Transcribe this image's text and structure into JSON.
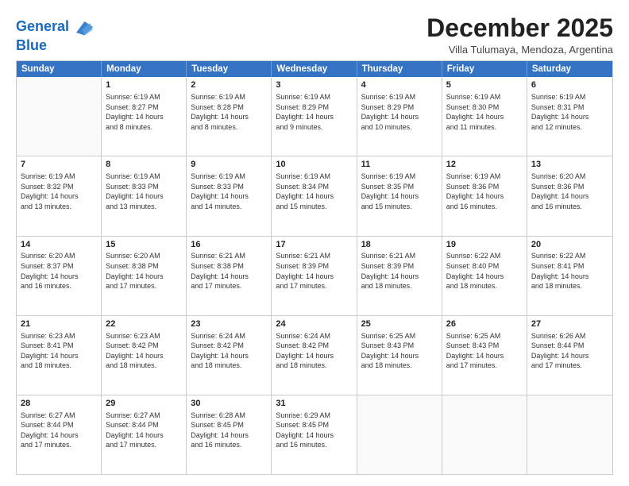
{
  "logo": {
    "line1": "General",
    "line2": "Blue"
  },
  "title": "December 2025",
  "subtitle": "Villa Tulumaya, Mendoza, Argentina",
  "header_days": [
    "Sunday",
    "Monday",
    "Tuesday",
    "Wednesday",
    "Thursday",
    "Friday",
    "Saturday"
  ],
  "weeks": [
    [
      {
        "day": "",
        "info": ""
      },
      {
        "day": "1",
        "info": "Sunrise: 6:19 AM\nSunset: 8:27 PM\nDaylight: 14 hours\nand 8 minutes."
      },
      {
        "day": "2",
        "info": "Sunrise: 6:19 AM\nSunset: 8:28 PM\nDaylight: 14 hours\nand 8 minutes."
      },
      {
        "day": "3",
        "info": "Sunrise: 6:19 AM\nSunset: 8:29 PM\nDaylight: 14 hours\nand 9 minutes."
      },
      {
        "day": "4",
        "info": "Sunrise: 6:19 AM\nSunset: 8:29 PM\nDaylight: 14 hours\nand 10 minutes."
      },
      {
        "day": "5",
        "info": "Sunrise: 6:19 AM\nSunset: 8:30 PM\nDaylight: 14 hours\nand 11 minutes."
      },
      {
        "day": "6",
        "info": "Sunrise: 6:19 AM\nSunset: 8:31 PM\nDaylight: 14 hours\nand 12 minutes."
      }
    ],
    [
      {
        "day": "7",
        "info": "Sunrise: 6:19 AM\nSunset: 8:32 PM\nDaylight: 14 hours\nand 13 minutes."
      },
      {
        "day": "8",
        "info": "Sunrise: 6:19 AM\nSunset: 8:33 PM\nDaylight: 14 hours\nand 13 minutes."
      },
      {
        "day": "9",
        "info": "Sunrise: 6:19 AM\nSunset: 8:33 PM\nDaylight: 14 hours\nand 14 minutes."
      },
      {
        "day": "10",
        "info": "Sunrise: 6:19 AM\nSunset: 8:34 PM\nDaylight: 14 hours\nand 15 minutes."
      },
      {
        "day": "11",
        "info": "Sunrise: 6:19 AM\nSunset: 8:35 PM\nDaylight: 14 hours\nand 15 minutes."
      },
      {
        "day": "12",
        "info": "Sunrise: 6:19 AM\nSunset: 8:36 PM\nDaylight: 14 hours\nand 16 minutes."
      },
      {
        "day": "13",
        "info": "Sunrise: 6:20 AM\nSunset: 8:36 PM\nDaylight: 14 hours\nand 16 minutes."
      }
    ],
    [
      {
        "day": "14",
        "info": "Sunrise: 6:20 AM\nSunset: 8:37 PM\nDaylight: 14 hours\nand 16 minutes."
      },
      {
        "day": "15",
        "info": "Sunrise: 6:20 AM\nSunset: 8:38 PM\nDaylight: 14 hours\nand 17 minutes."
      },
      {
        "day": "16",
        "info": "Sunrise: 6:21 AM\nSunset: 8:38 PM\nDaylight: 14 hours\nand 17 minutes."
      },
      {
        "day": "17",
        "info": "Sunrise: 6:21 AM\nSunset: 8:39 PM\nDaylight: 14 hours\nand 17 minutes."
      },
      {
        "day": "18",
        "info": "Sunrise: 6:21 AM\nSunset: 8:39 PM\nDaylight: 14 hours\nand 18 minutes."
      },
      {
        "day": "19",
        "info": "Sunrise: 6:22 AM\nSunset: 8:40 PM\nDaylight: 14 hours\nand 18 minutes."
      },
      {
        "day": "20",
        "info": "Sunrise: 6:22 AM\nSunset: 8:41 PM\nDaylight: 14 hours\nand 18 minutes."
      }
    ],
    [
      {
        "day": "21",
        "info": "Sunrise: 6:23 AM\nSunset: 8:41 PM\nDaylight: 14 hours\nand 18 minutes."
      },
      {
        "day": "22",
        "info": "Sunrise: 6:23 AM\nSunset: 8:42 PM\nDaylight: 14 hours\nand 18 minutes."
      },
      {
        "day": "23",
        "info": "Sunrise: 6:24 AM\nSunset: 8:42 PM\nDaylight: 14 hours\nand 18 minutes."
      },
      {
        "day": "24",
        "info": "Sunrise: 6:24 AM\nSunset: 8:42 PM\nDaylight: 14 hours\nand 18 minutes."
      },
      {
        "day": "25",
        "info": "Sunrise: 6:25 AM\nSunset: 8:43 PM\nDaylight: 14 hours\nand 18 minutes."
      },
      {
        "day": "26",
        "info": "Sunrise: 6:25 AM\nSunset: 8:43 PM\nDaylight: 14 hours\nand 17 minutes."
      },
      {
        "day": "27",
        "info": "Sunrise: 6:26 AM\nSunset: 8:44 PM\nDaylight: 14 hours\nand 17 minutes."
      }
    ],
    [
      {
        "day": "28",
        "info": "Sunrise: 6:27 AM\nSunset: 8:44 PM\nDaylight: 14 hours\nand 17 minutes."
      },
      {
        "day": "29",
        "info": "Sunrise: 6:27 AM\nSunset: 8:44 PM\nDaylight: 14 hours\nand 17 minutes."
      },
      {
        "day": "30",
        "info": "Sunrise: 6:28 AM\nSunset: 8:45 PM\nDaylight: 14 hours\nand 16 minutes."
      },
      {
        "day": "31",
        "info": "Sunrise: 6:29 AM\nSunset: 8:45 PM\nDaylight: 14 hours\nand 16 minutes."
      },
      {
        "day": "",
        "info": ""
      },
      {
        "day": "",
        "info": ""
      },
      {
        "day": "",
        "info": ""
      }
    ]
  ]
}
